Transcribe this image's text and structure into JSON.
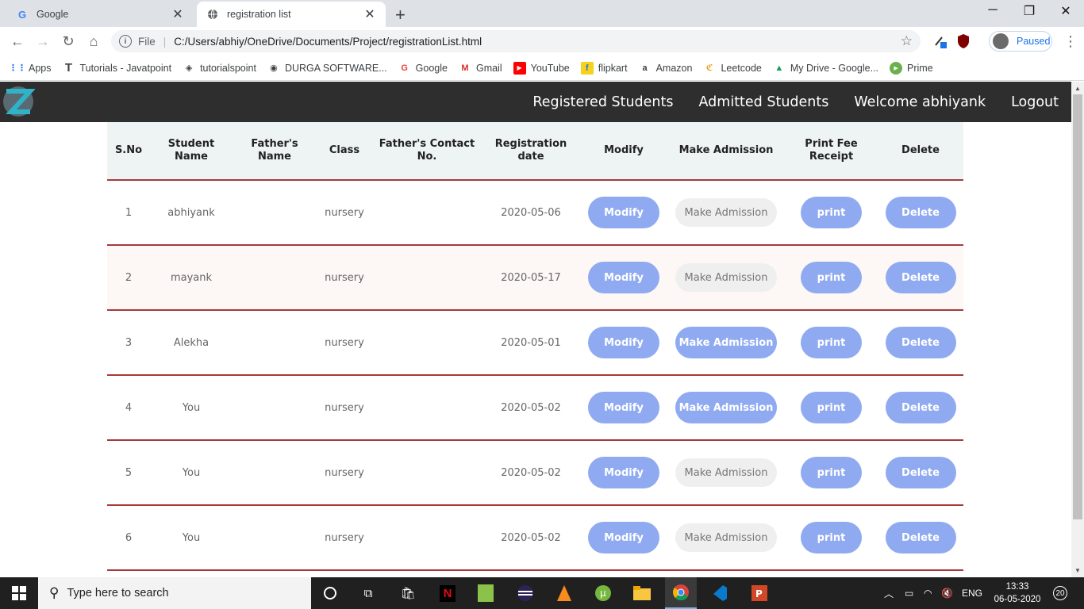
{
  "browser": {
    "tabs": [
      {
        "title": "Google",
        "favicon": "google-g-icon"
      },
      {
        "title": "registration list",
        "favicon": "globe-icon"
      }
    ],
    "omnibox": {
      "scheme_label": "File",
      "url": "C:/Users/abhiy/OneDrive/Documents/Project/registrationList.html"
    },
    "profile_label": "Paused",
    "bookmarks": [
      {
        "label": "Apps",
        "icon": "apps-grid-icon"
      },
      {
        "label": "Tutorials - Javatpoint",
        "icon": "javatpoint-icon"
      },
      {
        "label": "tutorialspoint",
        "icon": "tutorialspoint-icon"
      },
      {
        "label": "DURGA SOFTWARE...",
        "icon": "globe-icon"
      },
      {
        "label": "Google",
        "icon": "google-g-icon"
      },
      {
        "label": "Gmail",
        "icon": "gmail-icon"
      },
      {
        "label": "YouTube",
        "icon": "youtube-icon"
      },
      {
        "label": "flipkart",
        "icon": "flipkart-icon"
      },
      {
        "label": "Amazon",
        "icon": "amazon-icon"
      },
      {
        "label": "Leetcode",
        "icon": "leetcode-icon"
      },
      {
        "label": "My Drive - Google...",
        "icon": "google-drive-icon"
      },
      {
        "label": "Prime",
        "icon": "prime-video-icon"
      }
    ]
  },
  "nav": {
    "links": [
      "Registered Students",
      "Admitted Students",
      "Welcome abhiyank",
      "Logout"
    ]
  },
  "table": {
    "headers": [
      "S.No",
      "Student Name",
      "Father's Name",
      "Class",
      "Father's Contact No.",
      "Registration date",
      "Modify",
      "Make Admission",
      "Print Fee Receipt",
      "Delete"
    ],
    "modify_label": "Modify",
    "admission_label": "Make Admission",
    "print_label": "print",
    "delete_label": "Delete",
    "rows": [
      {
        "sno": "1",
        "name": "abhiyank",
        "father": "",
        "class": "nursery",
        "contact": "",
        "date": "2020-05-06",
        "admission_enabled": false
      },
      {
        "sno": "2",
        "name": "mayank",
        "father": "",
        "class": "nursery",
        "contact": "",
        "date": "2020-05-17",
        "admission_enabled": false
      },
      {
        "sno": "3",
        "name": "Alekha",
        "father": "",
        "class": "nursery",
        "contact": "",
        "date": "2020-05-01",
        "admission_enabled": true
      },
      {
        "sno": "4",
        "name": "You",
        "father": "",
        "class": "nursery",
        "contact": "",
        "date": "2020-05-02",
        "admission_enabled": true
      },
      {
        "sno": "5",
        "name": "You",
        "father": "",
        "class": "nursery",
        "contact": "",
        "date": "2020-05-02",
        "admission_enabled": false
      },
      {
        "sno": "6",
        "name": "You",
        "father": "",
        "class": "nursery",
        "contact": "",
        "date": "2020-05-02",
        "admission_enabled": false
      }
    ]
  },
  "taskbar": {
    "search_placeholder": "Type here to search",
    "language": "ENG",
    "time": "13:33",
    "date": "06-05-2020",
    "notification_count": "20"
  },
  "colors": {
    "accent_button": "#8faaf0",
    "row_border": "#a63a3a",
    "nav_bg": "#2e2e2e"
  }
}
